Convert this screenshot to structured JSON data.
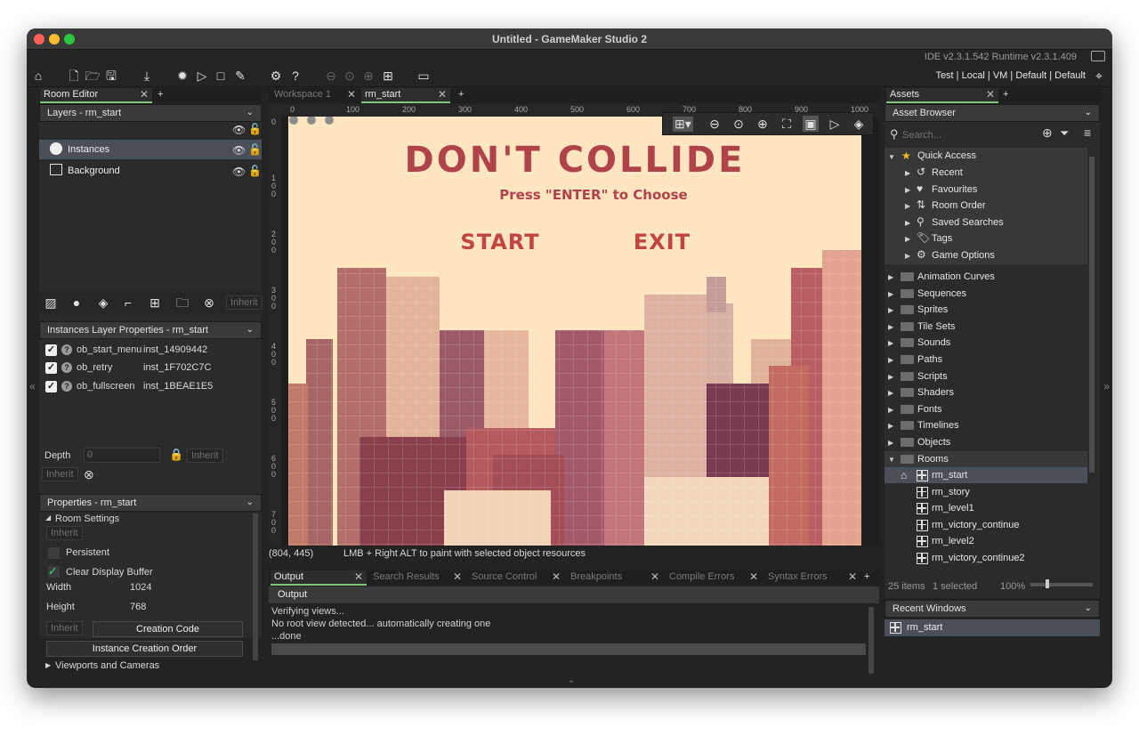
{
  "window": {
    "title": "Untitled - GameMaker Studio 2",
    "version": "IDE v2.3.1.542  Runtime v2.3.1.409"
  },
  "toolbar": {
    "target": "Test | Local | VM | Default | Default"
  },
  "left": {
    "tab_label": "Room Editor",
    "layers_header": "Layers - rm_start",
    "layers": [
      "Instances",
      "Background"
    ],
    "inherit": "Inherit",
    "instances_header": "Instances Layer Properties - rm_start",
    "instances": [
      {
        "name": "ob_start_menu",
        "id": "inst_14909442"
      },
      {
        "name": "ob_retry",
        "id": "inst_1F702C7C"
      },
      {
        "name": "ob_fullscreen",
        "id": "inst_1BEAE1E5"
      }
    ],
    "depth_label": "Depth",
    "depth_value": "0",
    "props_header": "Properties - rm_start",
    "room_settings": "Room Settings",
    "persistent": "Persistent",
    "clear_display": "Clear Display Buffer",
    "width_label": "Width",
    "width_value": "1024",
    "height_label": "Height",
    "height_value": "768",
    "creation_code": "Creation Code",
    "instance_order": "Instance Creation Order",
    "viewports": "Viewports and Cameras"
  },
  "center": {
    "tabs": [
      "Workspace 1",
      "rm_start"
    ],
    "ruler_x": [
      "0",
      "100",
      "200",
      "300",
      "400",
      "500",
      "600",
      "700",
      "800",
      "900",
      "1000"
    ],
    "ruler_y": [
      "0",
      "1\n0\n0",
      "2\n0\n0",
      "3\n0\n0",
      "4\n0\n0",
      "5\n0\n0",
      "6\n0\n0",
      "7\n0\n0"
    ],
    "game_title": "DON'T COLLIDE",
    "game_subtitle": "Press \"ENTER\" to Choose",
    "menu_start": "START",
    "menu_exit": "EXIT",
    "coords": "(804, 445)",
    "status_hint": "LMB + Right ALT to paint with selected object resources"
  },
  "output": {
    "tabs": [
      "Output",
      "Search Results",
      "Source Control",
      "Breakpoints",
      "Compile Errors",
      "Syntax Errors"
    ],
    "header": "Output",
    "lines": [
      "Verifying views...",
      "No root view detected... automatically creating one",
      "...done"
    ]
  },
  "right": {
    "tab_label": "Assets",
    "browser_header": "Asset Browser",
    "search_placeholder": "Search...",
    "quick_access": "Quick Access",
    "quick_items": [
      "Recent",
      "Favourites",
      "Room Order",
      "Saved Searches",
      "Tags",
      "Game Options"
    ],
    "folders": [
      "Animation Curves",
      "Sequences",
      "Sprites",
      "Tile Sets",
      "Sounds",
      "Paths",
      "Scripts",
      "Shaders",
      "Fonts",
      "Timelines",
      "Objects",
      "Rooms"
    ],
    "rooms": [
      "rm_start",
      "rm_story",
      "rm_level1",
      "rm_victory_continue",
      "rm_level2",
      "rm_victory_continue2"
    ],
    "items_count": "25 items",
    "selected_count": "1 selected",
    "zoom": "100%",
    "recent_header": "Recent Windows",
    "recent_item": "rm_start"
  }
}
